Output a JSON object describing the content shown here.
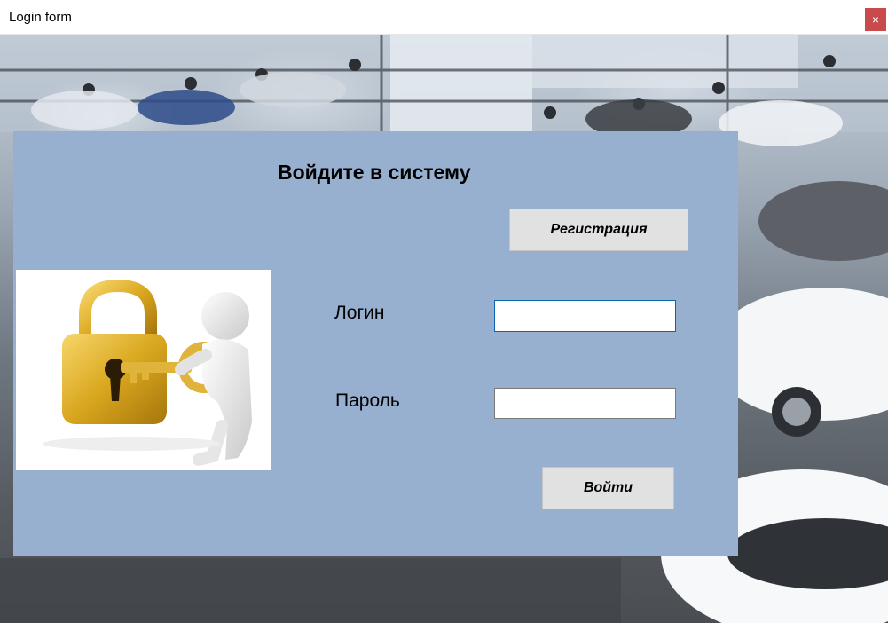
{
  "window": {
    "title": "Login form",
    "close_label": "×"
  },
  "form": {
    "heading": "Войдите в систему",
    "register_label": "Регистрация",
    "login_label": "Логин",
    "password_label": "Пароль",
    "submit_label": "Войти",
    "login_value": "",
    "password_value": ""
  },
  "colors": {
    "panel": "#97b0cf",
    "button": "#e1e1e1",
    "close_button": "#c84a4a",
    "focus_border": "#0a64b4"
  },
  "icons": {
    "lock_picture": "padlock-key-figure-icon"
  }
}
